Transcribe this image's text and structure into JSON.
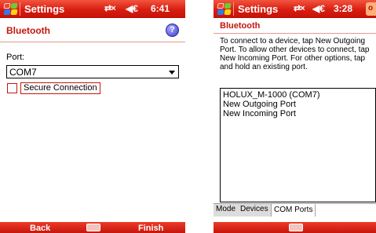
{
  "left": {
    "titlebar": {
      "title": "Settings",
      "time": "6:41",
      "conn_glyph": "⇄×",
      "volume_glyph": "◀€"
    },
    "header": {
      "title": "Bluetooth"
    },
    "port_label": "Port:",
    "port_value": "COM7",
    "secure_label": "Secure Connection",
    "secure_checked": false,
    "softkeys": {
      "left": "Back",
      "right": "Finish"
    }
  },
  "right": {
    "titlebar": {
      "title": "Settings",
      "time": "3:28",
      "ok_stub": "o",
      "conn_glyph": "⇄×",
      "volume_glyph": "◀€"
    },
    "header": {
      "title": "Bluetooth"
    },
    "instructions": "To connect to a device, tap New Outgoing Port. To allow other devices to connect, tap New Incoming Port. For other options, tap and hold an existing port.",
    "ports": [
      "HOLUX_M-1000 (COM7)",
      "New Outgoing Port",
      "New Incoming Port"
    ],
    "tabs": [
      {
        "label": "Mode",
        "active": false
      },
      {
        "label": "Devices",
        "active": false
      },
      {
        "label": "COM Ports",
        "active": true
      }
    ]
  },
  "colors": {
    "titlebar": "#d81d10",
    "header_text": "#c5160d",
    "softbar": "#c5160d"
  },
  "icons": [
    "windows-start-icon",
    "connectivity-icon",
    "volume-icon",
    "help-icon",
    "keyboard-icon",
    "dropdown-arrow-icon"
  ]
}
